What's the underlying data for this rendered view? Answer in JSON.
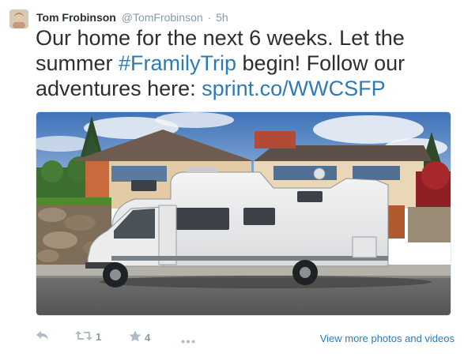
{
  "author": {
    "name": "Tom Frobinson",
    "handle": "@TomFrobinson",
    "separator": "·",
    "time": "5h"
  },
  "tweet": {
    "text_1": "Our home for the next 6 weeks. Let the summer ",
    "hashtag": "#FramilyTrip",
    "text_2": " begin! Follow our adventures here: ",
    "link": "sprint.co/WWCSFP"
  },
  "actions": {
    "retweet_count": "1",
    "favorite_count": "4",
    "view_more": "View more photos and videos"
  },
  "icons": {
    "reply": "reply-icon",
    "retweet": "retweet-icon",
    "favorite": "star-icon",
    "more": "more-icon"
  },
  "colors": {
    "link": "#2b7bb9",
    "text": "#292f33",
    "muted": "#8899a6",
    "icon": "#b1bbc3"
  }
}
